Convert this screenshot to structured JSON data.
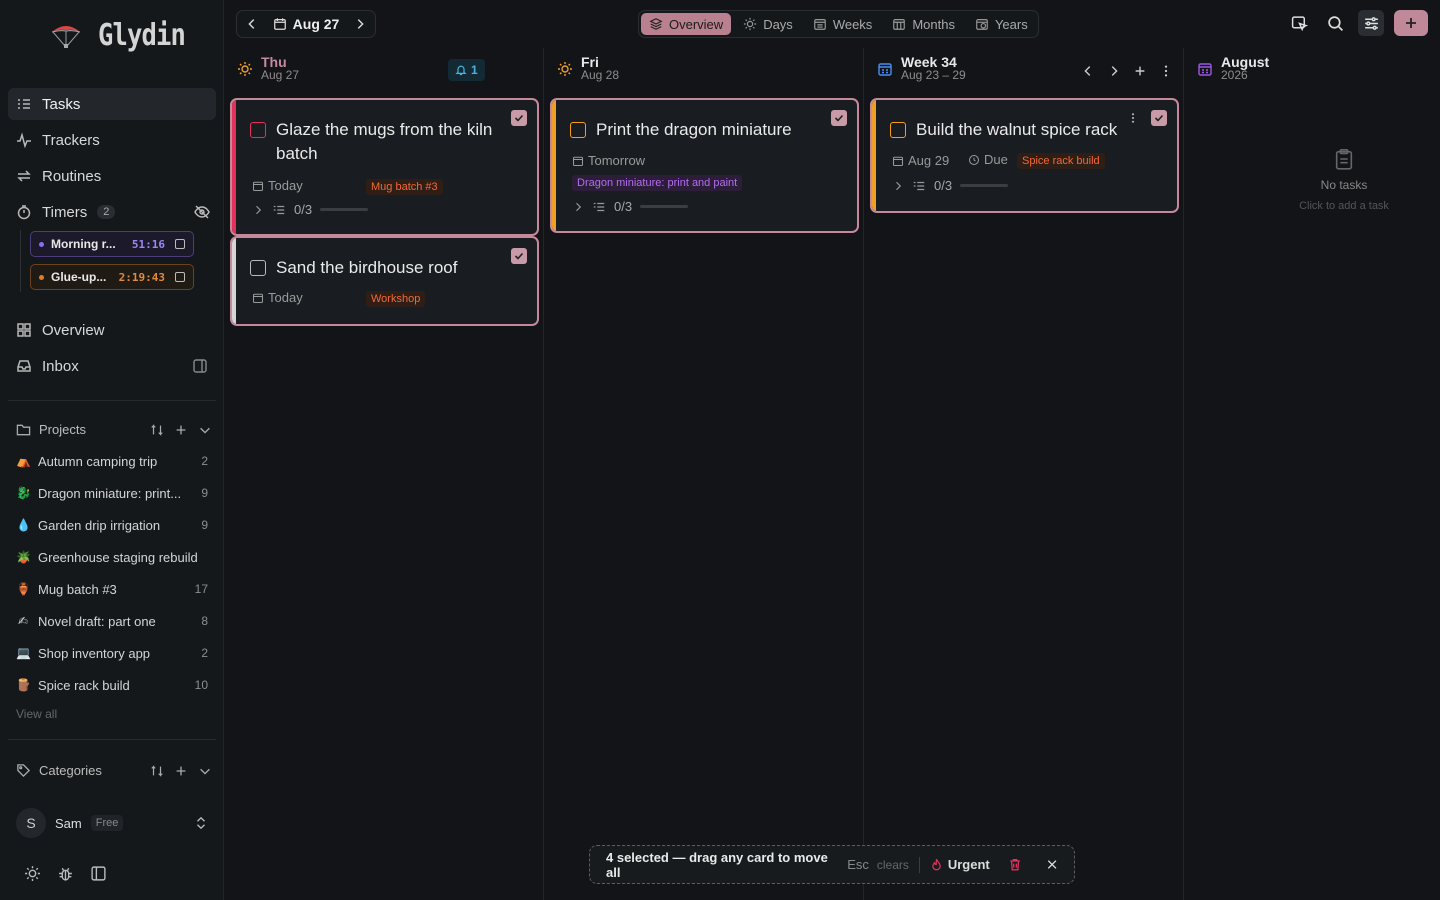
{
  "app": {
    "name": "Glydin"
  },
  "sidebar": {
    "nav": [
      {
        "label": "Tasks",
        "icon": "tasks-icon"
      },
      {
        "label": "Trackers",
        "icon": "activity-icon"
      },
      {
        "label": "Routines",
        "icon": "repeat-icon"
      },
      {
        "label": "Timers",
        "icon": "timer-icon",
        "count": "2"
      }
    ],
    "timers": [
      {
        "name": "Morning r...",
        "time": "51:16",
        "color": "#8d6cf0"
      },
      {
        "name": "Glue-up...",
        "time": "2:19:43",
        "color": "#e07a2c"
      }
    ],
    "nav2": [
      {
        "label": "Overview",
        "icon": "grid-icon"
      },
      {
        "label": "Inbox",
        "icon": "inbox-icon"
      }
    ],
    "projects_label": "Projects",
    "projects": [
      {
        "emoji": "⛺",
        "name": "Autumn camping trip",
        "count": "2"
      },
      {
        "emoji": "🐉",
        "name": "Dragon miniature: print...",
        "count": "9"
      },
      {
        "emoji": "💧",
        "name": "Garden drip irrigation",
        "count": "9"
      },
      {
        "emoji": "🪴",
        "name": "Greenhouse staging rebuild",
        "count": ""
      },
      {
        "emoji": "🏺",
        "name": "Mug batch #3",
        "count": "17"
      },
      {
        "emoji": "✍",
        "name": "Novel draft: part one",
        "count": "8"
      },
      {
        "emoji": "💻",
        "name": "Shop inventory app",
        "count": "2"
      },
      {
        "emoji": "🪵",
        "name": "Spice rack build",
        "count": "10"
      }
    ],
    "view_all": "View all",
    "categories_label": "Categories",
    "user": {
      "initial": "S",
      "name": "Sam",
      "plan": "Free"
    }
  },
  "topbar": {
    "date": "Aug 27",
    "tabs": [
      "Overview",
      "Days",
      "Weeks",
      "Months",
      "Years"
    ],
    "active_tab": "Overview"
  },
  "columns": {
    "thu": {
      "day": "Thu",
      "date": "Aug 27",
      "notif": "1"
    },
    "fri": {
      "day": "Fri",
      "date": "Aug 28"
    },
    "week": {
      "title": "Week 34",
      "range": "Aug 23 – 29"
    },
    "month": {
      "title": "August",
      "year": "2026",
      "empty_title": "No tasks",
      "empty_hint": "Click to add a task"
    }
  },
  "cards": {
    "c1": {
      "title": "Glaze the mugs from the kiln batch",
      "date": "Today",
      "tag": "Mug batch #3",
      "progress": "0/3",
      "progress_done": 0,
      "stripe": "#e0325a"
    },
    "c2": {
      "title": "Sand the birdhouse roof",
      "date": "Today",
      "tag": "Workshop",
      "stripe": "#d6d6d6"
    },
    "c3": {
      "title": "Print the dragon miniature",
      "date": "Tomorrow",
      "tag": "Dragon miniature: print and paint",
      "progress": "0/3",
      "progress_done": 0,
      "stripe": "#f0a020"
    },
    "c4": {
      "title": "Build the walnut spice rack",
      "date": "Aug 29",
      "due": "Due",
      "tag": "Spice rack build",
      "progress": "0/3",
      "progress_done": 0,
      "stripe": "#f0a020"
    }
  },
  "selection": {
    "text": "4 selected — drag any card to move all",
    "key": "Esc",
    "key_label": "clears",
    "urgent": "Urgent"
  }
}
